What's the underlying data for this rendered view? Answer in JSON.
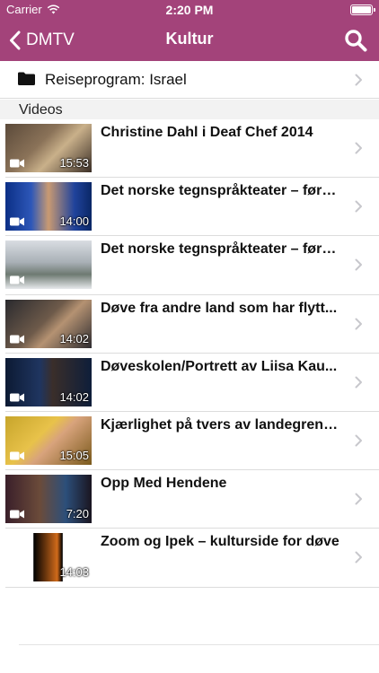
{
  "status_bar": {
    "carrier": "Carrier",
    "time": "2:20 PM"
  },
  "nav": {
    "back_label": "DMTV",
    "title": "Kultur"
  },
  "folder": {
    "label": "Reiseprogram: Israel"
  },
  "section": {
    "title": "Videos"
  },
  "videos": [
    {
      "title": "Christine Dahl i Deaf Chef 2014",
      "duration": "15:53"
    },
    {
      "title": "Det norske tegnspråkteater – førs...",
      "duration": "14:00"
    },
    {
      "title": "Det norske tegnspråkteater – førs...",
      "duration": ""
    },
    {
      "title": "Døve fra andre land som har flytt...",
      "duration": "14:02"
    },
    {
      "title": "Døveskolen/Portrett av Liisa Kau...",
      "duration": "14:02"
    },
    {
      "title": "Kjærlighet på tvers av landegrens...",
      "duration": "15:05"
    },
    {
      "title": "Opp Med Hendene",
      "duration": "7:20"
    },
    {
      "title": "Zoom og Ipek – kulturside for døve",
      "duration": "14:03"
    }
  ],
  "colors": {
    "nav_bar": "#a3437a",
    "separator": "#dcdcdc",
    "section_bg": "#f2f2f2"
  },
  "icons": [
    "wifi-icon",
    "battery-icon",
    "back-chevron-icon",
    "search-icon",
    "folder-icon",
    "chevron-right-icon",
    "video-camera-icon"
  ]
}
